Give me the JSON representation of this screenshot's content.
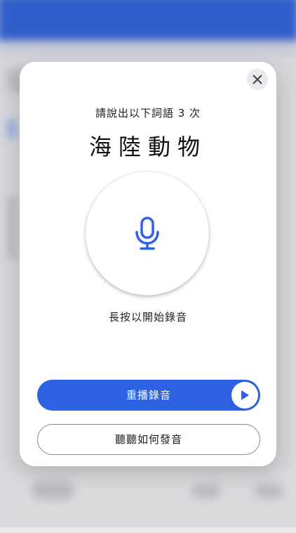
{
  "modal": {
    "instruction": "請說出以下詞語 3 次",
    "target_word": "海陸動物",
    "hold_hint": "長按以開始錄音",
    "replay_label": "重播錄音",
    "how_label": "聽聽如何發音"
  },
  "icons": {
    "close": "close-icon",
    "mic": "microphone-icon",
    "play": "play-icon"
  },
  "colors": {
    "accent": "#2f61e3",
    "background_topbar": "#2f61d9"
  }
}
